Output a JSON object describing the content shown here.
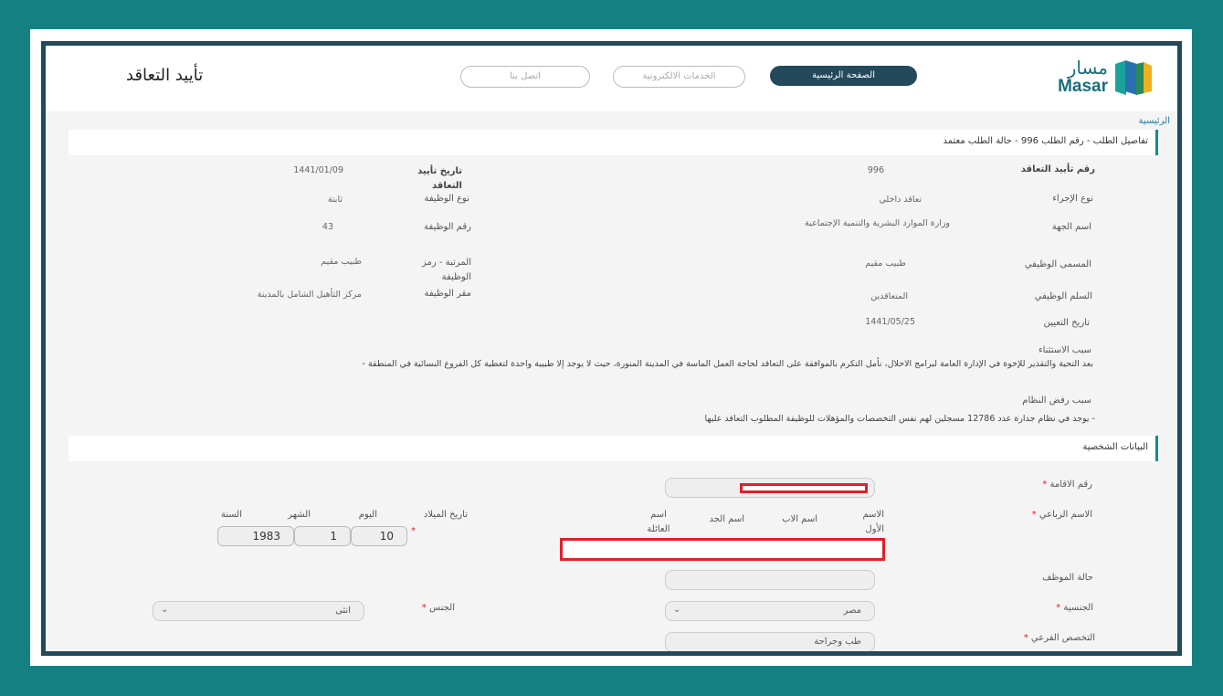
{
  "header": {
    "logo_ar": "مسار",
    "logo_en": "Masar",
    "nav": [
      {
        "label": "الصفحة الرئيسية"
      },
      {
        "label": "الخدمات الالكترونية"
      },
      {
        "label": "اتصل بنا"
      }
    ],
    "page_title": "تأييد التعاقد"
  },
  "breadcrumb": "الرئيسية",
  "request_bar": "تفاصيل الطلب - رقم الطلب 996 - حالة الطلب معتمد",
  "details": {
    "contract_no_label": "رقم تأييد التعاقد",
    "contract_no": "996",
    "confirm_date_label": "تاريخ تأييد التعاقد",
    "confirm_date": "1441/01/09",
    "procedure_type_label": "نوع الإجراء",
    "procedure_type": "تعاقد داخلي",
    "job_type_label": "نوع الوظيفة",
    "job_type": "ثابتة",
    "entity_label": "اسم الجهة",
    "entity": "وزارة الموارد البشرية والتنمية الإجتماعية",
    "job_no_label": "رقم الوظيفة",
    "job_no": "43",
    "job_title_label": "المسمى الوظيفي",
    "job_title": "طبيب مقيم",
    "rank_label": "المرتبة - رمز الوظيفة",
    "rank": "طبيب مقيم",
    "scale_label": "السلم الوظيفي",
    "scale": "المتعاقدين",
    "location_label": "مقر الوظيفة",
    "location": "مركز التأهيل الشامل بالمدينة",
    "appointment_date_label": "تاريخ التعيين",
    "appointment_date": "1441/05/25",
    "exception_reason_label": "سبب الاستثناء",
    "exception_reason": "بعد التحية والتقدير للإخوة في الإدارة العامة لبرامج الاحلال، نأمل التكرم بالموافقة على التعاقد لحاجة العمل الماسة في المدينة المنورة، حيث لا يوجد إلا طبيبة واحدة لتغطية كل الفروع النسائية في المنطقة -",
    "system_reject_label": "سبب رفض النظام",
    "system_reject": "- يوجد في نظام جدارة عدد 12786 مسجلين لهم نفس التخصصات والمؤهلات للوظيفة المطلوب التعاقد عليها"
  },
  "personal": {
    "section_title": "البيانات الشخصية",
    "residence_label": "رقم الاقامة",
    "fullname_label": "الاسم الرباعي",
    "name_parts": [
      "الاسم الأول",
      "اسم الاب",
      "اسم الجد",
      "اسم العائلة"
    ],
    "birthdate_label": "تاريخ الميلاد",
    "day_label": "اليوم",
    "month_label": "الشهر",
    "year_label": "السنة",
    "day": "10",
    "month": "1",
    "year": "1983",
    "employee_status_label": "حالة الموظف",
    "nationality_label": "الجنسية",
    "nationality": "مصر",
    "gender_label": "الجنس",
    "gender": "انثى",
    "specialty_label": "التخصص الفرعي",
    "specialty": "طب وجراحة",
    "required_mark": "*"
  },
  "colors": {
    "teal_bg": "#158081",
    "navy": "#23495a",
    "accent": "#1b8a8c",
    "red": "#e0202a"
  }
}
